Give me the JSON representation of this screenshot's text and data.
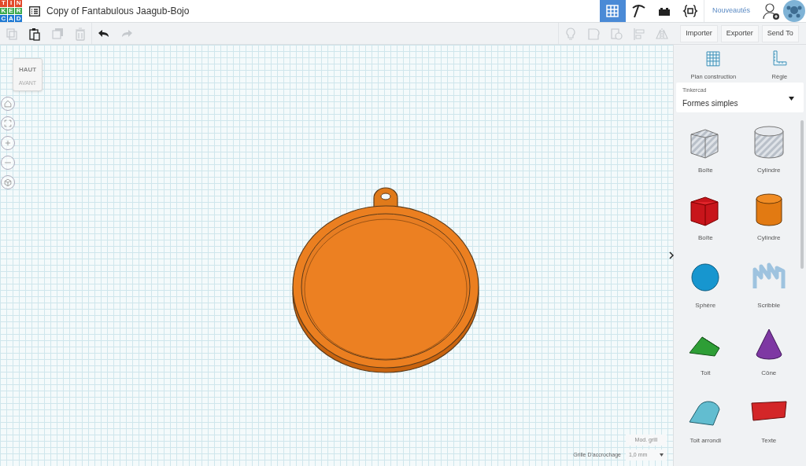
{
  "header": {
    "logo_letters": [
      "T",
      "I",
      "N",
      "K",
      "E",
      "R",
      "C",
      "A",
      "D"
    ],
    "title": "Copy of Fantabulous Jaagub-Bojo",
    "modes": [
      {
        "kind": "grid",
        "selected": true
      },
      {
        "kind": "pickaxe",
        "selected": false
      },
      {
        "kind": "bricks",
        "selected": false
      },
      {
        "kind": "codeblocks",
        "selected": false
      }
    ],
    "news_link": "Nouveautés"
  },
  "toolbar": {
    "edit_tools": [
      {
        "kind": "copy",
        "disabled": true
      },
      {
        "kind": "paste",
        "disabled": false
      },
      {
        "kind": "duplicate",
        "disabled": true
      },
      {
        "kind": "delete",
        "disabled": true
      },
      {
        "kind": "undo",
        "disabled": false
      },
      {
        "kind": "redo",
        "disabled": true
      }
    ],
    "shape_tools": [
      {
        "kind": "bulb",
        "disabled": true
      },
      {
        "kind": "group",
        "disabled": true
      },
      {
        "kind": "ungroup",
        "disabled": true
      },
      {
        "kind": "align",
        "disabled": true
      },
      {
        "kind": "mirror",
        "disabled": true
      }
    ],
    "buttons": [
      "Importer",
      "Exporter",
      "Send To"
    ]
  },
  "view_cube": {
    "top": "HAUT",
    "front": "AVANT"
  },
  "view_controls": [
    {
      "kind": "home"
    },
    {
      "kind": "fit"
    },
    {
      "kind": "zoom-in"
    },
    {
      "kind": "zoom-out"
    },
    {
      "kind": "perspective"
    }
  ],
  "panel": {
    "tools": [
      {
        "kind": "workplane",
        "label": "Plan construction"
      },
      {
        "kind": "ruler",
        "label": "Règle"
      }
    ],
    "library": {
      "source": "Tinkercad",
      "name": "Formes simples"
    },
    "shapes": [
      {
        "kind": "box-hole",
        "label": "Boîte"
      },
      {
        "kind": "cylinder-hole",
        "label": "Cylindre"
      },
      {
        "kind": "box",
        "label": "Boîte"
      },
      {
        "kind": "cylinder",
        "label": "Cylindre"
      },
      {
        "kind": "sphere",
        "label": "Sphère"
      },
      {
        "kind": "scribble",
        "label": "Scribble"
      },
      {
        "kind": "roof",
        "label": "Toit"
      },
      {
        "kind": "cone",
        "label": "Cône"
      },
      {
        "kind": "round-roof",
        "label": "Toit arrondi"
      },
      {
        "kind": "text",
        "label": "Texte"
      }
    ]
  },
  "grid_settings": {
    "edit_button": "Mod. grill",
    "snap_label": "Grille D'accrochage",
    "snap_value": "1,0 mm"
  }
}
